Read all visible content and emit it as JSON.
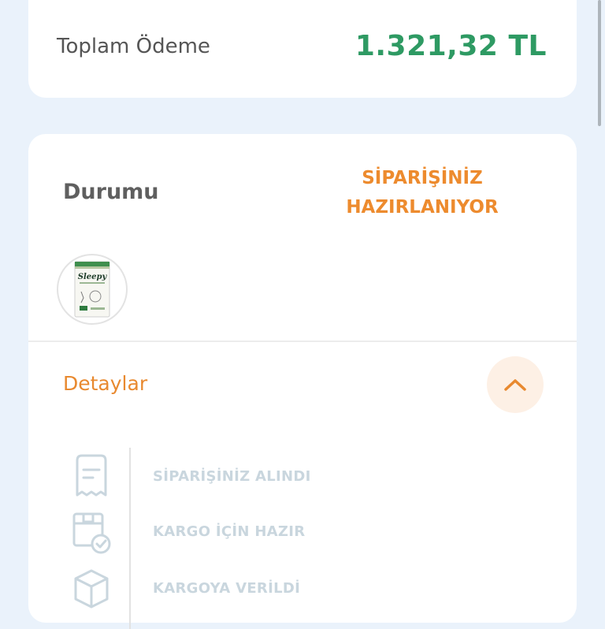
{
  "summary": {
    "total_label": "Toplam Ödeme",
    "total_value": "1.321,32 TL",
    "partial_label": "",
    "partial_value": ""
  },
  "order": {
    "status_label": "Durumu",
    "status_value_line1": "SİPARİŞİNİZ",
    "status_value_line2": "HAZIRLANIYOR",
    "product_thumb": {
      "brand_text": "Sleepy"
    },
    "details_label": "Detaylar",
    "timeline": [
      {
        "label": "SİPARİŞİNİZ ALINDI",
        "icon": "receipt-icon"
      },
      {
        "label": "KARGO İÇİN HAZIR",
        "icon": "box-check-icon"
      },
      {
        "label": "KARGOYA VERİLDİ",
        "icon": "package-icon"
      }
    ]
  },
  "colors": {
    "background": "#EAF2FB",
    "total_green": "#2E9A63",
    "accent_orange": "#ED8B2E",
    "timeline_muted": "#C9D6DE"
  }
}
